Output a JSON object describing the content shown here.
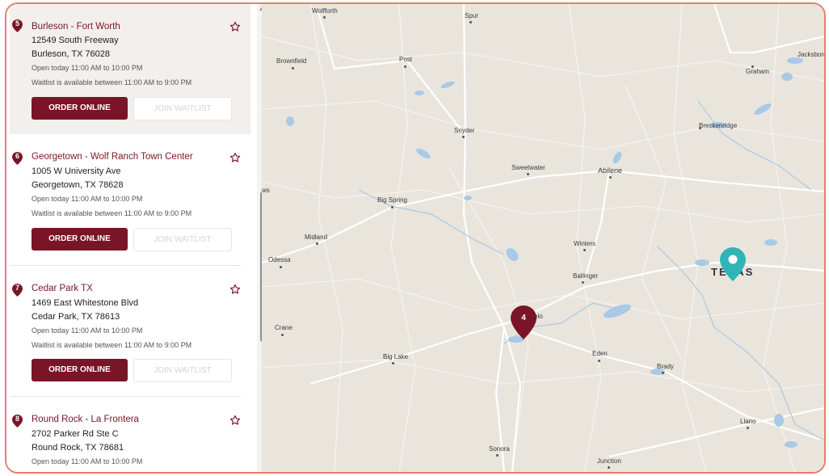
{
  "locations": [
    {
      "number": "5",
      "name": "Burleson - Fort Worth",
      "address1": "12549 South Freeway",
      "address2": "Burleson, TX 76028",
      "hours": "Open today 11:00 AM to 10:00 PM",
      "waitlist": "Waitlist is available between 11:00 AM to 9:00 PM",
      "order_label": "ORDER ONLINE",
      "join_label": "JOIN WAITLIST"
    },
    {
      "number": "6",
      "name": "Georgetown - Wolf Ranch Town Center",
      "address1": "1005 W University Ave",
      "address2": "Georgetown, TX 78628",
      "hours": "Open today 11:00 AM to 10:00 PM",
      "waitlist": "Waitlist is available between 11:00 AM to 9:00 PM",
      "order_label": "ORDER ONLINE",
      "join_label": "JOIN WAITLIST"
    },
    {
      "number": "7",
      "name": "Cedar Park TX",
      "address1": "1469 East Whitestone Blvd",
      "address2": "Cedar Park, TX 78613",
      "hours": "Open today 11:00 AM to 10:00 PM",
      "waitlist": "Waitlist is available between 11:00 AM to 9:00 PM",
      "order_label": "ORDER ONLINE",
      "join_label": "JOIN WAITLIST"
    },
    {
      "number": "8",
      "name": "Round Rock - La Frontera",
      "address1": "2702 Parker Rd Ste C",
      "address2": "Round Rock, TX 78681",
      "hours": "Open today 11:00 AM to 10:00 PM"
    }
  ],
  "map": {
    "cities": [
      "Wolfforth",
      "Spur",
      "Jacksboro",
      "Graham",
      "Brownfield",
      "Post",
      "Snyder",
      "Breckenridge",
      "Sweetwater",
      "Abilene",
      "Big Spring",
      "ws",
      "Midland",
      "Winters",
      "Odessa",
      "Ballinger",
      "elo",
      "Crane",
      "Big Lake",
      "Eden",
      "Brady",
      "Llano",
      "Sonora",
      "Junction"
    ],
    "state_label": "TEXAS",
    "cluster_count": "4",
    "cluster_color": "#7a1527",
    "user_pin_color": "#2fb5b8",
    "road_color": "#ffffff",
    "water_color": "#a9c9e6",
    "land_color": "#e9e5dd"
  },
  "colors": {
    "brand": "#7a1527",
    "frame_border": "#e5806d"
  }
}
